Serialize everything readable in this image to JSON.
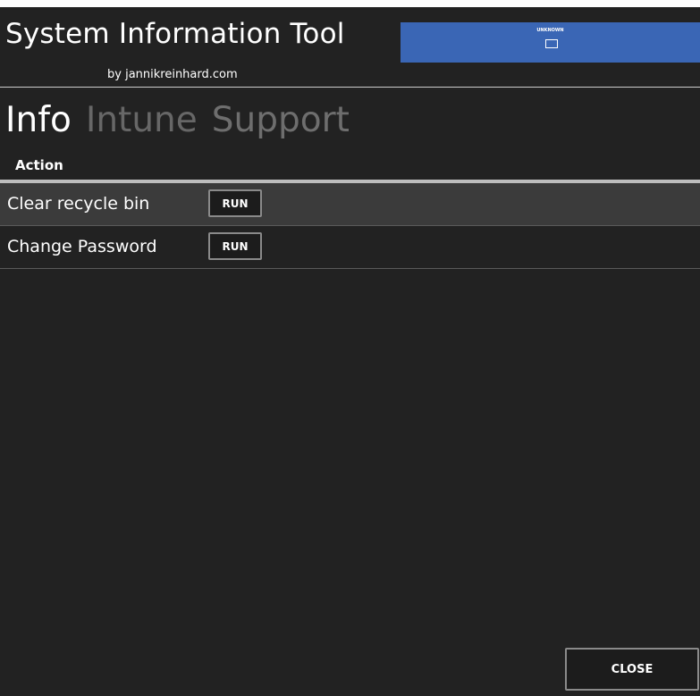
{
  "app": {
    "title": "System Information Tool",
    "byline": "by jannikreinhard.com"
  },
  "user_tile": {
    "username": "UNKNOWN",
    "icon": "monitor-icon",
    "color": "#3a66b5"
  },
  "tabs": [
    {
      "label": "Info",
      "active": true
    },
    {
      "label": "Intune",
      "active": false
    },
    {
      "label": "Support",
      "active": false
    }
  ],
  "actions_table": {
    "column_header": "Action",
    "rows": [
      {
        "label": "Clear recycle bin",
        "button": "RUN",
        "selected": true
      },
      {
        "label": "Change Password",
        "button": "RUN",
        "selected": false
      }
    ]
  },
  "footer": {
    "close_label": "CLOSE"
  },
  "colors": {
    "background": "#222222",
    "selected_row": "#3b3b3b",
    "accent": "#3a66b5"
  }
}
